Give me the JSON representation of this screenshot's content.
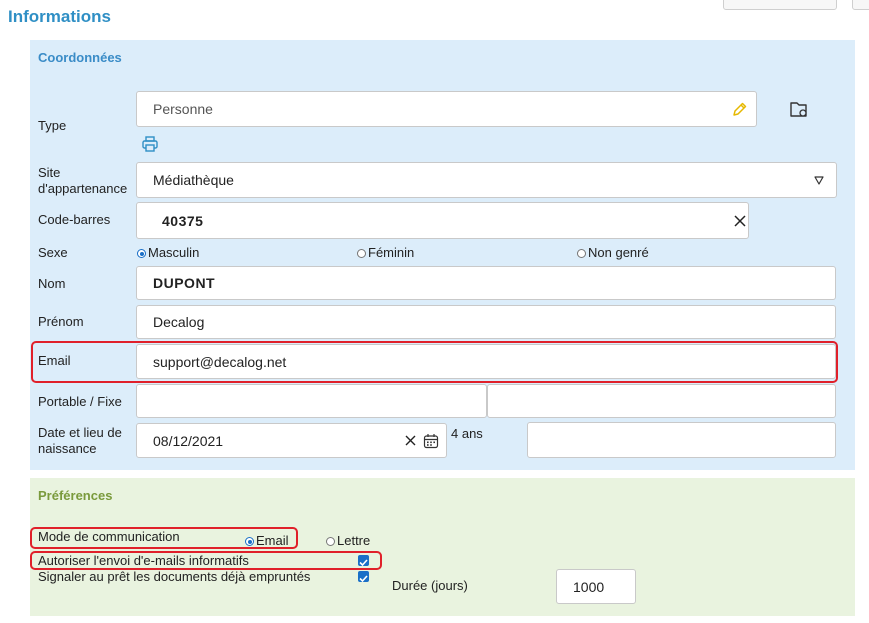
{
  "page": {
    "title": "Informations"
  },
  "coordonnees": {
    "title": "Coordonnées",
    "type": {
      "label": "Type",
      "value": "Personne"
    },
    "site": {
      "label": "Site d'appartenance",
      "value": "Médiathèque"
    },
    "barcode": {
      "label": "Code-barres",
      "value": "40375"
    },
    "sexe": {
      "label": "Sexe",
      "options": [
        "Masculin",
        "Féminin",
        "Non genré"
      ],
      "selected": "Masculin"
    },
    "nom": {
      "label": "Nom",
      "value": "DUPONT"
    },
    "prenom": {
      "label": "Prénom",
      "value": "Decalog"
    },
    "email": {
      "label": "Email",
      "value": "support@decalog.net"
    },
    "portable": {
      "label": "Portable / Fixe",
      "value1": "",
      "value2": ""
    },
    "naissance": {
      "label": "Date et lieu de naissance",
      "date": "08/12/2021",
      "age": "4 ans",
      "lieu": ""
    }
  },
  "preferences": {
    "title": "Préférences",
    "mode": {
      "label": "Mode de communication",
      "options": [
        "Email",
        "Lettre"
      ],
      "selected": "Email"
    },
    "autoriser": {
      "label": "Autoriser l'envoi d'e-mails informatifs",
      "checked": true
    },
    "signaler": {
      "label": "Signaler au prêt les documents déjà empruntés",
      "checked": true
    },
    "duree": {
      "label": "Durée (jours)",
      "value": "1000"
    }
  },
  "icons": {
    "edit": "pencil-icon",
    "folder": "folder-icon",
    "print": "printer-icon",
    "dropdown": "chevron-down-icon",
    "clear": "close-icon",
    "calendar": "calendar-icon",
    "checkmark": "checkmark-icon"
  },
  "colors": {
    "title": "#2f8fc5",
    "coord_bg": "#dcedfa",
    "pref_bg": "#e9f3df",
    "pref_title": "#7a9a3c",
    "accent": "#1a6fc7",
    "highlight": "#e0202a",
    "edit_icon": "#e6b800"
  }
}
